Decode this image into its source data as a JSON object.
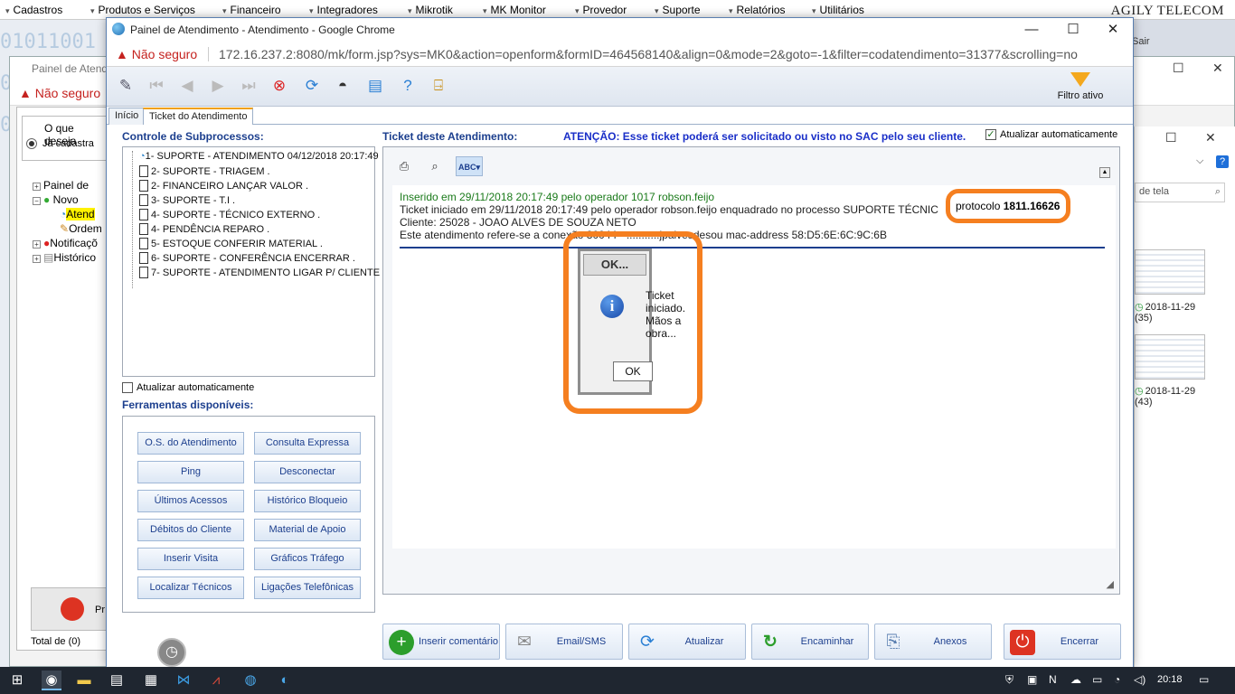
{
  "top_menu": [
    "Cadastros",
    "Produtos e Serviços",
    "Financeiro",
    "Integradores",
    "Mikrotik",
    "MK Monitor",
    "Provedor",
    "Suporte",
    "Relatórios",
    "Utilitários"
  ],
  "brand": "AGILY TELECOM",
  "bg_window": {
    "title": "Painel de Atendi",
    "security": "Não seguro",
    "sair": "Sair",
    "question_label": "O que deseja",
    "radio_label": "Já cadastra",
    "tree": [
      "Painel de",
      "Novo",
      "Atend",
      "Ordem",
      "Notificaçõ",
      "Histórico"
    ],
    "bell_label": "Pr",
    "total": "Total de (0)",
    "search_placeholder": "de tela",
    "thumb1_label": "2018-11-29",
    "thumb1_count": "(35)",
    "thumb2_label": "2018-11-29",
    "thumb2_count": "(43)"
  },
  "chrome": {
    "title": "Painel de Atendimento - Atendimento - Google Chrome",
    "security": "Não seguro",
    "url": "172.16.237.2:8080/mk/form.jsp?sys=MK0&action=openform&formID=464568140&align=0&mode=2&goto=-1&filter=codatendimento=31377&scrolling=no"
  },
  "toolbar": {
    "filtro": "Filtro ativo"
  },
  "tabs": [
    "Início",
    "Ticket do Atendimento"
  ],
  "left": {
    "subproc_title": "Controle de Subprocessos:",
    "subprocesses": [
      "1- SUPORTE - ATENDIMENTO 04/12/2018 20:17:49",
      "2- SUPORTE - TRIAGEM .",
      "2- FINANCEIRO LANÇAR VALOR .",
      "3- SUPORTE - T.I .",
      "4- SUPORTE - TÉCNICO EXTERNO .",
      "4- PENDÊNCIA REPARO .",
      "5- ESTOQUE CONFERIR MATERIAL .",
      "6- SUPORTE - CONFERÊNCIA ENCERRAR .",
      "7- SUPORTE - ATENDIMENTO LIGAR P/ CLIENTE ."
    ],
    "auto_update": "Atualizar automaticamente",
    "tools_title": "Ferramentas disponíveis:",
    "tools": [
      "O.S. do Atendimento",
      "Consulta Expressa",
      "Ping",
      "Desconectar",
      "Últimos Acessos",
      "Histórico Bloqueio",
      "Débitos do Cliente",
      "Material de Apoio",
      "Inserir Visita",
      "Gráficos Tráfego",
      "Localizar Técnicos",
      "Ligações Telefônicas"
    ]
  },
  "ticket": {
    "title": "Ticket deste Atendimento:",
    "warning": "ATENÇÃO: Esse ticket poderá ser solicitado ou visto no SAC pelo seu cliente.",
    "auto_update": "Atualizar automaticamente",
    "lines": [
      "Inserido em 29/11/2018 20:17:49 pelo operador 1017 robson.feijo",
      "Ticket iniciado em 29/11/2018 20:17:49 pelo operador robson.feijo enquadrado no processo SUPORTE TÉCNIC",
      "Cliente: 25028 - JOAO ALVES DE SOUZA NETO",
      "Este atendimento refere-se a conexão 30044 - ...........jpalvesdesou mac-address 58:D5:6E:6C:9C:6B"
    ],
    "protocol_label": "protocolo",
    "protocol_value": "1811.16626"
  },
  "dialog": {
    "title": "OK...",
    "message": "Ticket iniciado. Mãos a obra...",
    "ok": "OK"
  },
  "actions": [
    "Inserir comentário",
    "Email/SMS",
    "Atualizar",
    "Encaminhar",
    "Anexos",
    "Encerrar"
  ],
  "taskbar": {
    "time": "20:18"
  }
}
